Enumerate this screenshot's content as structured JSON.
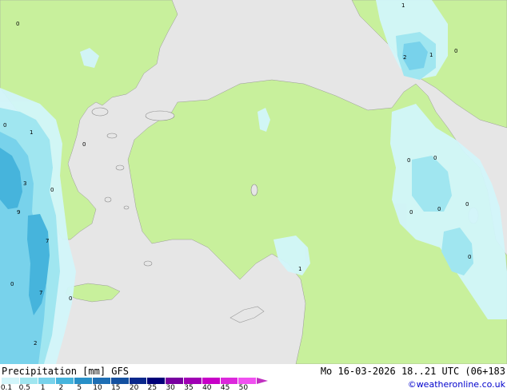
{
  "title": "Precipitation [mm] GFS",
  "datetime": "Mo 16-03-2026 18..21 UTC (06+183",
  "credit": "©weatheronline.co.uk",
  "colors": {
    "sea": "#e6e6e6",
    "land": "#c8f09c",
    "precip_0_1": "#d2f5fa",
    "precip_0_5": "#a0e6f0",
    "precip_1": "#78d2eb",
    "precip_2": "#46b4dc",
    "precip_5": "#2890c8"
  },
  "legend": {
    "ticks": [
      "0.1",
      "0.5",
      "1",
      "2",
      "5",
      "10",
      "15",
      "20",
      "25",
      "30",
      "35",
      "40",
      "45",
      "50"
    ],
    "colors": [
      "#d2f5fa",
      "#a0e6f0",
      "#78d2eb",
      "#46b4dc",
      "#2890c8",
      "#1e6eb4",
      "#1450a0",
      "#0a288c",
      "#000078",
      "#7800a0",
      "#a000b4",
      "#c800c8",
      "#dc28dc",
      "#f050f0"
    ]
  },
  "map_labels": [
    "0",
    "1",
    "2",
    "1",
    "0",
    "0",
    "1",
    "3",
    "0",
    "0",
    "9",
    "7",
    "7",
    "0",
    "0",
    "2",
    "1",
    "0",
    "0",
    "0",
    "0",
    "0",
    "0",
    "0"
  ]
}
